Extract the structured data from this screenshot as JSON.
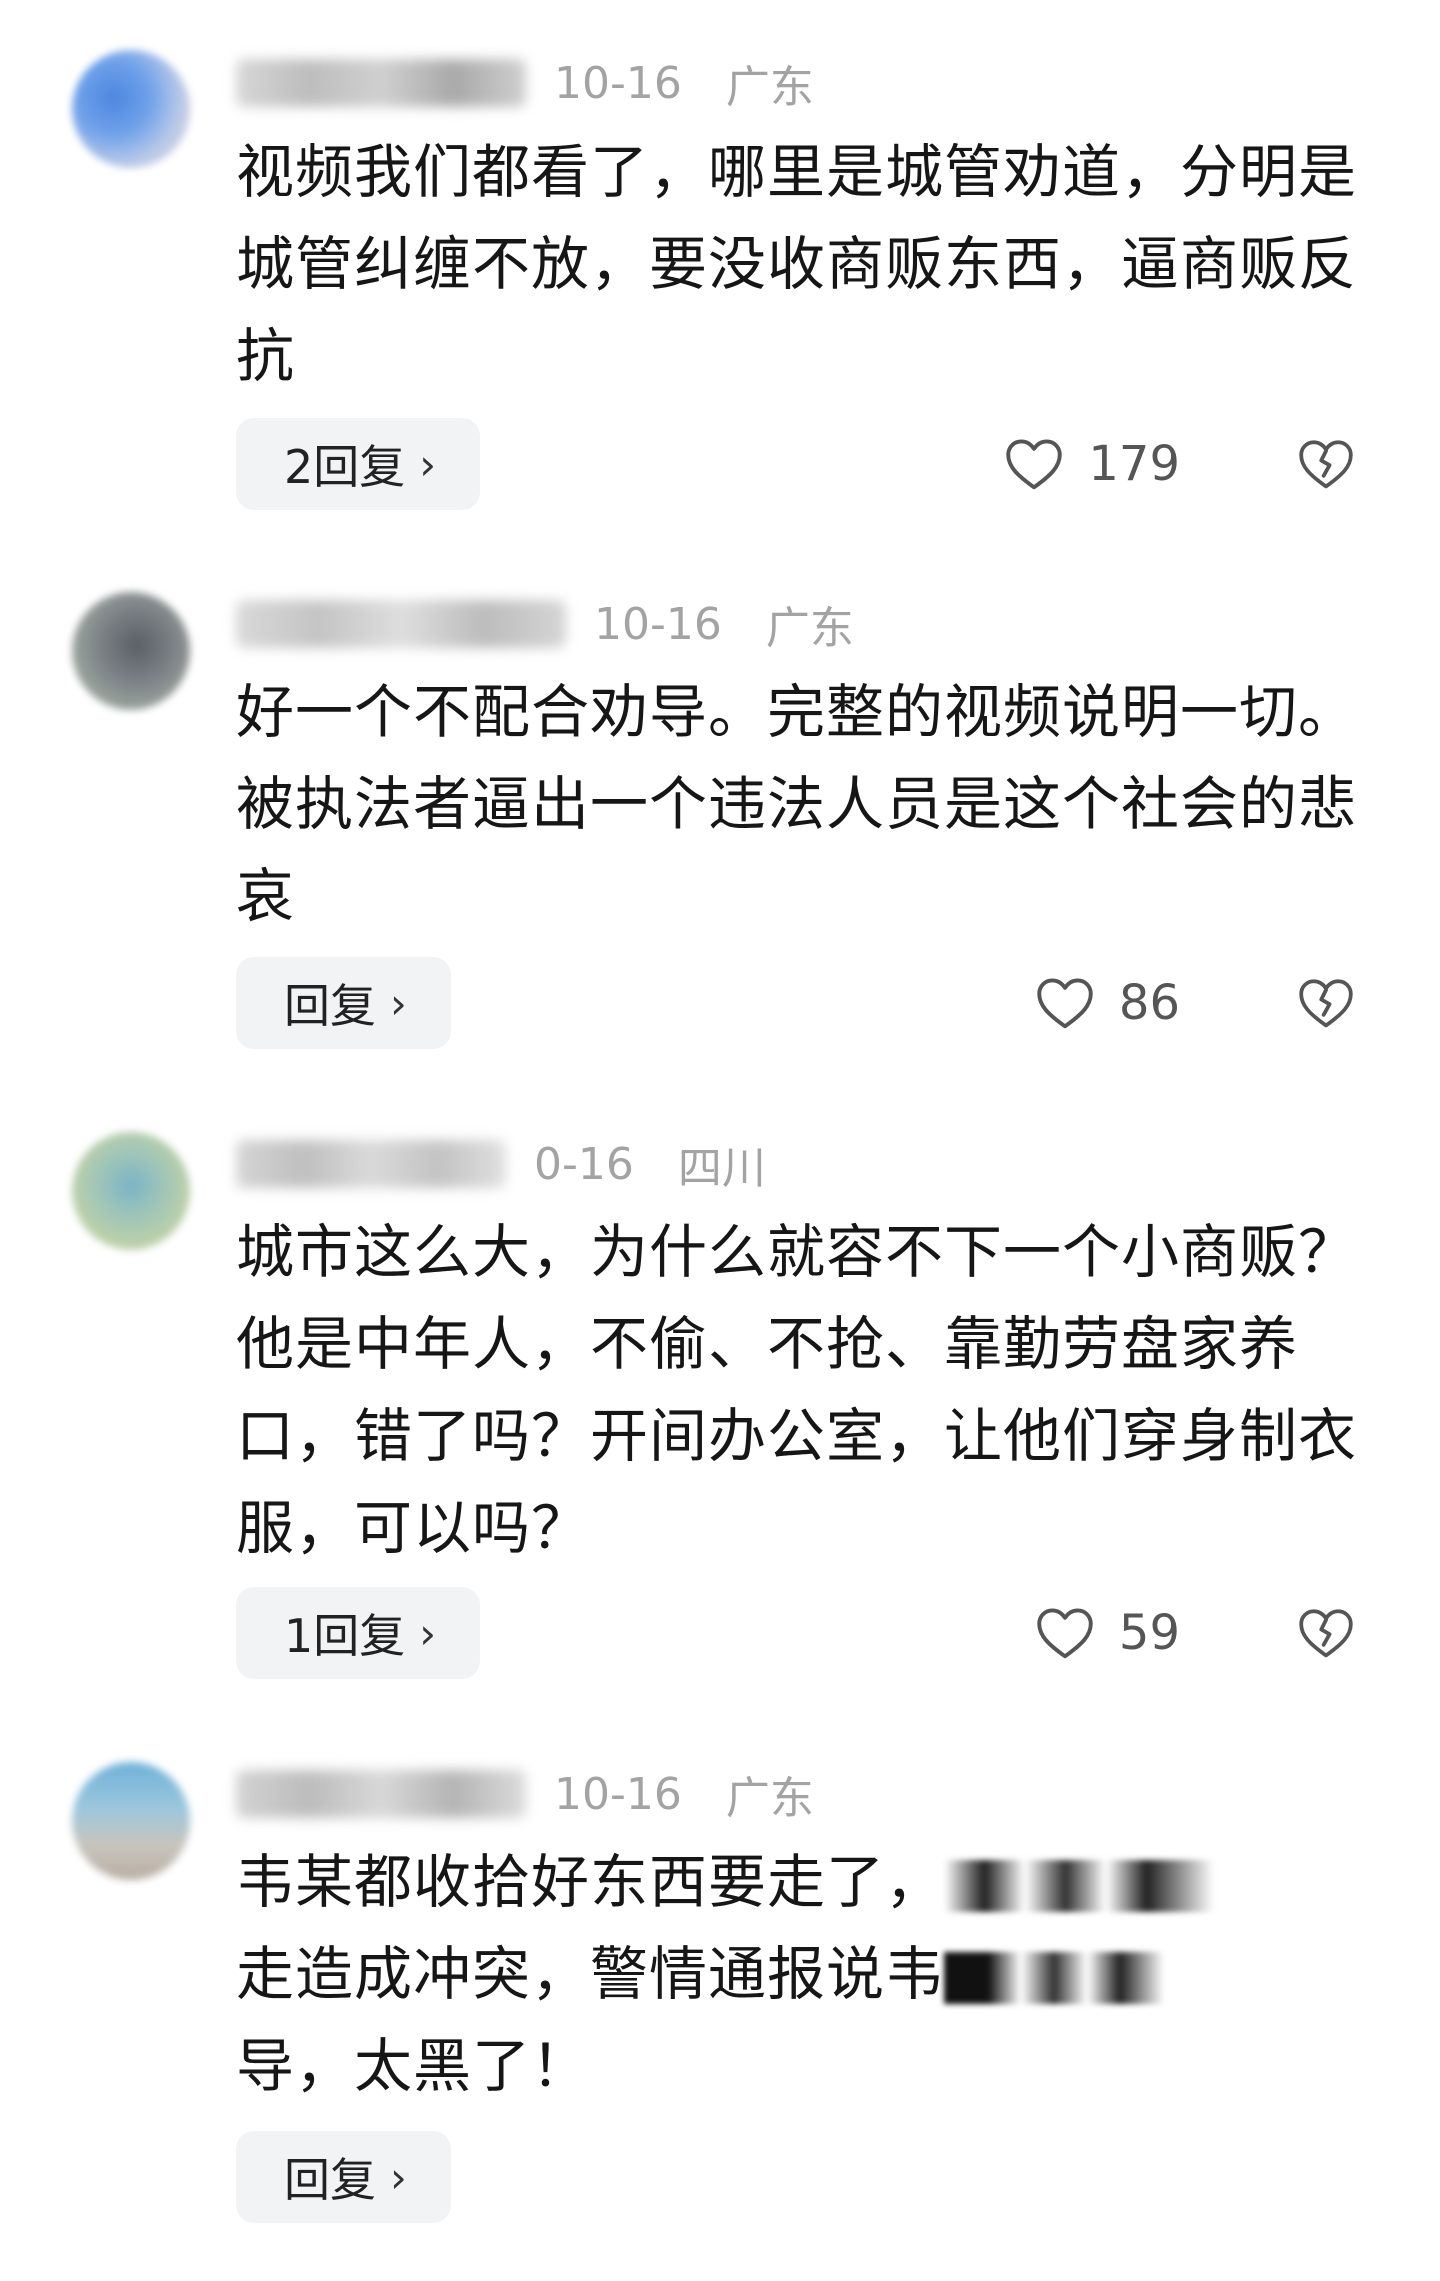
{
  "comments": [
    {
      "date": "10-16",
      "location": "广东",
      "text": "视频我们都看了，哪里是城管劝道，分明是城管纠缠不放，要没收商贩东西，逼商贩反抗",
      "reply_label": "2回复",
      "likes": "179"
    },
    {
      "date": "10-16",
      "location": "广东",
      "text": "好一个不配合劝导。完整的视频说明一切。被执法者逼出一个违法人员是这个社会的悲哀",
      "reply_label": "回复",
      "likes": "86"
    },
    {
      "date": "0-16",
      "location": "四川",
      "text": "城市这么大，为什么就容不下一个小商贩？他是中年人，不偷、不抢、靠勤劳盘家养口，错了吗？开间办公室，让他们穿身制衣服，可以吗？",
      "reply_label": "1回复",
      "likes": "59"
    },
    {
      "date": "10-16",
      "location": "广东",
      "text_line1": "韦某都收拾好东西要走了，",
      "text_line2": "走造成冲突，警情通报说韦",
      "text_line3": "导，太黑了！",
      "reply_label": "回复"
    }
  ],
  "icons": {
    "like": "heart-outline-icon",
    "dislike": "broken-heart-icon",
    "reply_chevron": "chevron-right-icon"
  },
  "colors": {
    "meta_gray": "#a3a3a3",
    "reply_bg": "#f2f3f5",
    "text": "#161616"
  }
}
